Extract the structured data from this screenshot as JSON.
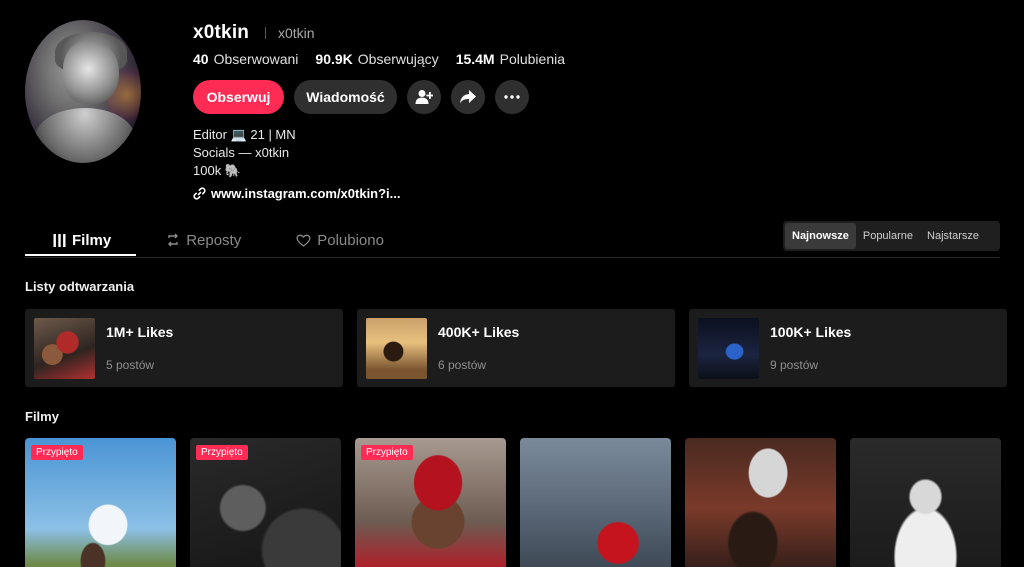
{
  "profile": {
    "username": "x0tkin",
    "nickname": "x0tkin",
    "stats": [
      {
        "value": "40",
        "label": "Obserwowani"
      },
      {
        "value": "90.9K",
        "label": "Obserwujący"
      },
      {
        "value": "15.4M",
        "label": "Polubienia"
      }
    ],
    "follow_label": "Obserwuj",
    "message_label": "Wiadomość",
    "bio": [
      "Editor 💻 21 | MN",
      "Socials — x0tkin",
      "100k 🐘"
    ],
    "link": "www.instagram.com/x0tkin?i..."
  },
  "tabs": [
    {
      "label": "Filmy",
      "icon": "grid-icon",
      "active": true
    },
    {
      "label": "Reposty",
      "icon": "repost-icon",
      "active": false
    },
    {
      "label": "Polubiono",
      "icon": "heart-outline-icon",
      "active": false
    }
  ],
  "sort": [
    "Najnowsze",
    "Popularne",
    "Najstarsze"
  ],
  "sections": {
    "playlists": "Listy odtwarzania",
    "videos": "Filmy"
  },
  "playlists": [
    {
      "title": "1M+ Likes",
      "count": "5 postów"
    },
    {
      "title": "400K+ Likes",
      "count": "6 postów"
    },
    {
      "title": "100K+ Likes",
      "count": "9 postów"
    }
  ],
  "videos": {
    "pinned_label": "Przypięto",
    "items": [
      {
        "pinned": true
      },
      {
        "pinned": true
      },
      {
        "pinned": true
      },
      {
        "pinned": false
      },
      {
        "pinned": false
      },
      {
        "pinned": false
      }
    ]
  },
  "colors": {
    "accent": "#fe2c55",
    "surface": "#1c1c1c",
    "background": "#000000"
  }
}
